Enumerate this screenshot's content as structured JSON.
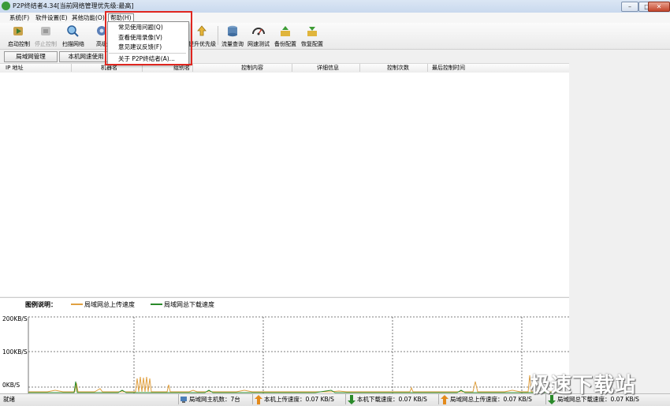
{
  "window": {
    "title": "P2P终结者4.34[当前网络管理优先级:最高]",
    "controls": [
      "–",
      "□",
      "✕"
    ]
  },
  "menubar": {
    "items": [
      "系统(F)",
      "软件设置(E)",
      "其他功能(O)",
      "帮助(H)"
    ]
  },
  "toolbar": {
    "items": [
      {
        "label": "启动控制",
        "icon": "play-icon",
        "enabled": true
      },
      {
        "label": "停止控制",
        "icon": "stop-icon",
        "enabled": false
      },
      {
        "label": "扫描网络",
        "icon": "scan-icon",
        "enabled": true
      },
      {
        "label": "高级",
        "icon": "advanced-icon",
        "enabled": true
      },
      {
        "label": "提升优先级",
        "icon": "priority-icon",
        "enabled": true
      },
      {
        "label": "流量查询",
        "icon": "database-icon",
        "enabled": true
      },
      {
        "label": "网速测试",
        "icon": "speedometer-icon",
        "enabled": true
      },
      {
        "label": "备份配置",
        "icon": "backup-icon",
        "enabled": true
      },
      {
        "label": "恢复配置",
        "icon": "restore-icon",
        "enabled": true
      }
    ]
  },
  "help_menu": {
    "items": [
      "常见使用问题(Q)",
      "查看使用录像(V)",
      "意见建议反馈(F)",
      "关于 P2P终结者(A)..."
    ]
  },
  "tabs": [
    "局域网管理",
    "本机网速使用"
  ],
  "table": {
    "columns": [
      "IP 地址",
      "机器名",
      "组别名",
      "控制内容",
      "详细信息",
      "控制次数",
      "最后控制时间"
    ],
    "rows": []
  },
  "legend": {
    "title": "图例说明：",
    "series": [
      {
        "name": "局域网总上传速度",
        "color": "#e0a040"
      },
      {
        "name": "局域网总下载速度",
        "color": "#2a8a2a"
      }
    ]
  },
  "graph": {
    "y_ticks": [
      "200KB/S",
      "100KB/S",
      "0KB/S"
    ],
    "upload_color": "#e0a040",
    "download_color": "#2a8a2a"
  },
  "statusbar": {
    "status": "就绪",
    "lan_hosts": "局域网主机数：7台",
    "local_upload": "本机上传速度：0.07 KB/S",
    "local_download": "本机下载速度：0.07 KB/S",
    "lan_upload": "局域网总上传速度：0.07 KB/S",
    "lan_download": "局域网总下载速度：0.07 KB/S"
  },
  "watermark": "极速下载站"
}
